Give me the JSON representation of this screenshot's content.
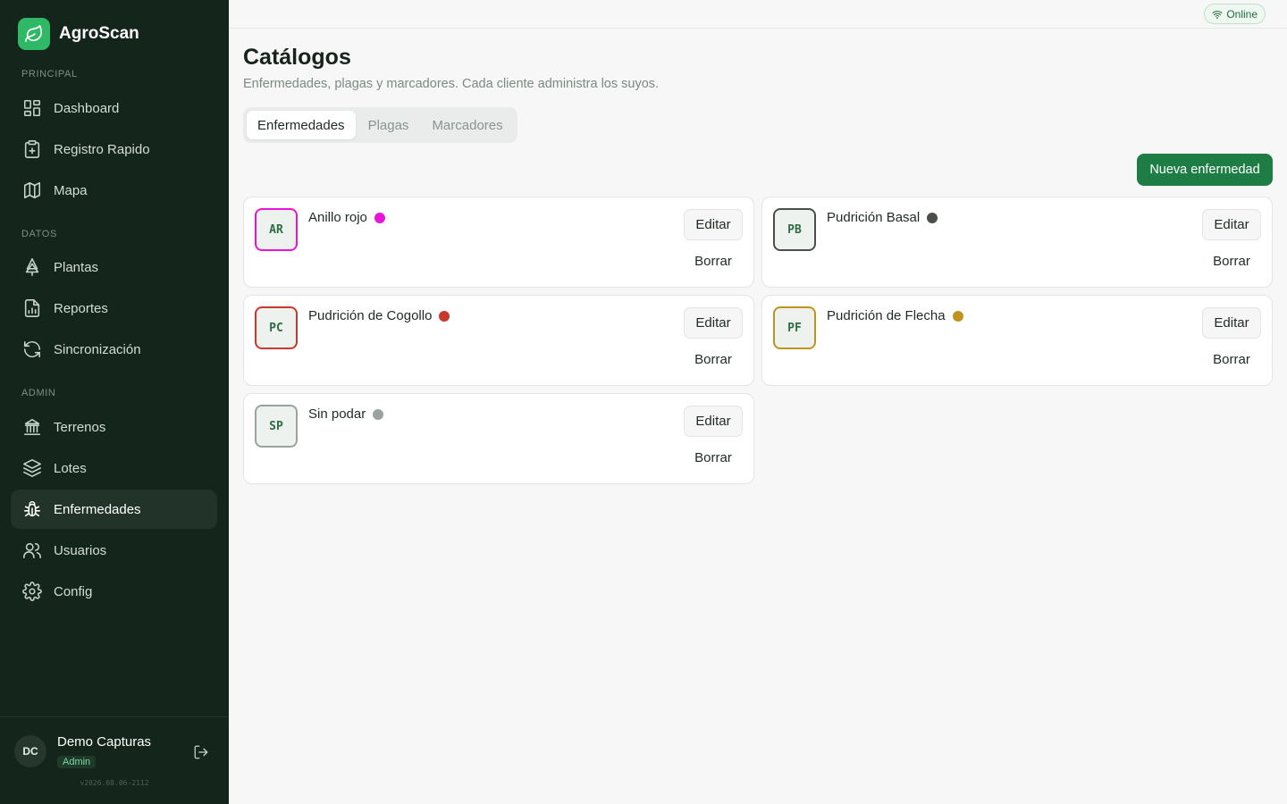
{
  "brand": {
    "name": "AgroScan",
    "icon": "leaf-icon",
    "color": "#2fb866"
  },
  "sections": {
    "principal": "PRINCIPAL",
    "datos": "DATOS",
    "admin": "ADMIN"
  },
  "nav": {
    "principal": [
      {
        "label": "Dashboard",
        "icon": "dashboard-icon"
      },
      {
        "label": "Registro Rapido",
        "icon": "clipboard-plus-icon"
      },
      {
        "label": "Mapa",
        "icon": "map-icon"
      }
    ],
    "datos": [
      {
        "label": "Plantas",
        "icon": "tree-icon"
      },
      {
        "label": "Reportes",
        "icon": "report-icon"
      },
      {
        "label": "Sincronización",
        "icon": "sync-icon"
      }
    ],
    "admin": [
      {
        "label": "Terrenos",
        "icon": "building-icon"
      },
      {
        "label": "Lotes",
        "icon": "layers-icon"
      },
      {
        "label": "Enfermedades",
        "icon": "bug-icon",
        "active": true
      },
      {
        "label": "Usuarios",
        "icon": "users-icon"
      },
      {
        "label": "Config",
        "icon": "gear-icon"
      }
    ]
  },
  "user": {
    "initials": "DC",
    "name": "Demo Capturas",
    "role": "Admin",
    "version": "v2026.08.06-2112"
  },
  "topbar": {
    "status": "Online"
  },
  "page": {
    "title": "Catálogos",
    "subtitle": "Enfermedades, plagas y marcadores. Cada cliente administra los suyos."
  },
  "tabs": [
    "Enfermedades",
    "Plagas",
    "Marcadores"
  ],
  "active_tab": "Enfermedades",
  "new_button": "Nueva enfermedad",
  "actions": {
    "edit": "Editar",
    "delete": "Borrar"
  },
  "diseases": [
    {
      "code": "AR",
      "name": "Anillo rojo",
      "color": "#e815d8"
    },
    {
      "code": "PB",
      "name": "Pudrición Basal",
      "color": "#4a4f4b"
    },
    {
      "code": "PC",
      "name": "Pudrición de Cogollo",
      "color": "#c8382e"
    },
    {
      "code": "PF",
      "name": "Pudrición de Flecha",
      "color": "#c0921e"
    },
    {
      "code": "SP",
      "name": "Sin podar",
      "color": "#9aa49e"
    }
  ]
}
